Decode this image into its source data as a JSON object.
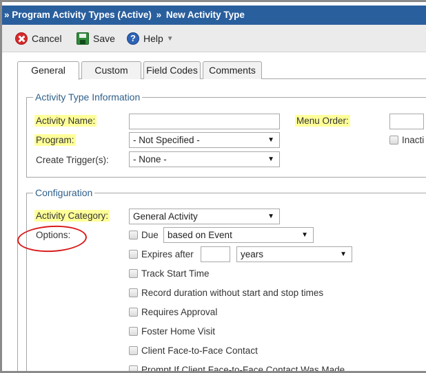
{
  "breadcrumb": {
    "prefix": "»",
    "parent": "Program Activity Types (Active)",
    "separator": "»",
    "current": "New Activity Type"
  },
  "toolbar": {
    "cancel_label": "Cancel",
    "save_label": "Save",
    "help_label": "Help"
  },
  "tabs": [
    {
      "label": "General",
      "active": true
    },
    {
      "label": "Custom",
      "active": false
    },
    {
      "label": "Field Codes",
      "active": false
    },
    {
      "label": "Comments",
      "active": false
    }
  ],
  "activity_info": {
    "legend": "Activity Type Information",
    "activity_name_label": "Activity Name:",
    "activity_name_value": "",
    "menu_order_label": "Menu Order:",
    "menu_order_value": "",
    "program_label": "Program:",
    "program_value": "- Not Specified -",
    "inactive_label": "Inacti",
    "create_trigger_label": "Create Trigger(s):",
    "create_trigger_value": "- None -"
  },
  "configuration": {
    "legend": "Configuration",
    "activity_category_label": "Activity Category:",
    "activity_category_value": "General Activity",
    "options_label": "Options:",
    "due_label": "Due",
    "due_value": "based on Event",
    "expires_label": "Expires after",
    "expires_amount": "",
    "expires_unit": "years",
    "options": [
      "Track Start Time",
      "Record duration without start and stop times",
      "Requires Approval",
      "Foster Home Visit",
      "Client Face-to-Face Contact",
      "Prompt If Client Face-to-Face Contact Was Made"
    ]
  },
  "colors": {
    "title_bar": "#2a5f9e",
    "legend_text": "#2e5f8a",
    "required_highlight": "#ffff99",
    "annotation_ellipse": "#d91a1a"
  }
}
